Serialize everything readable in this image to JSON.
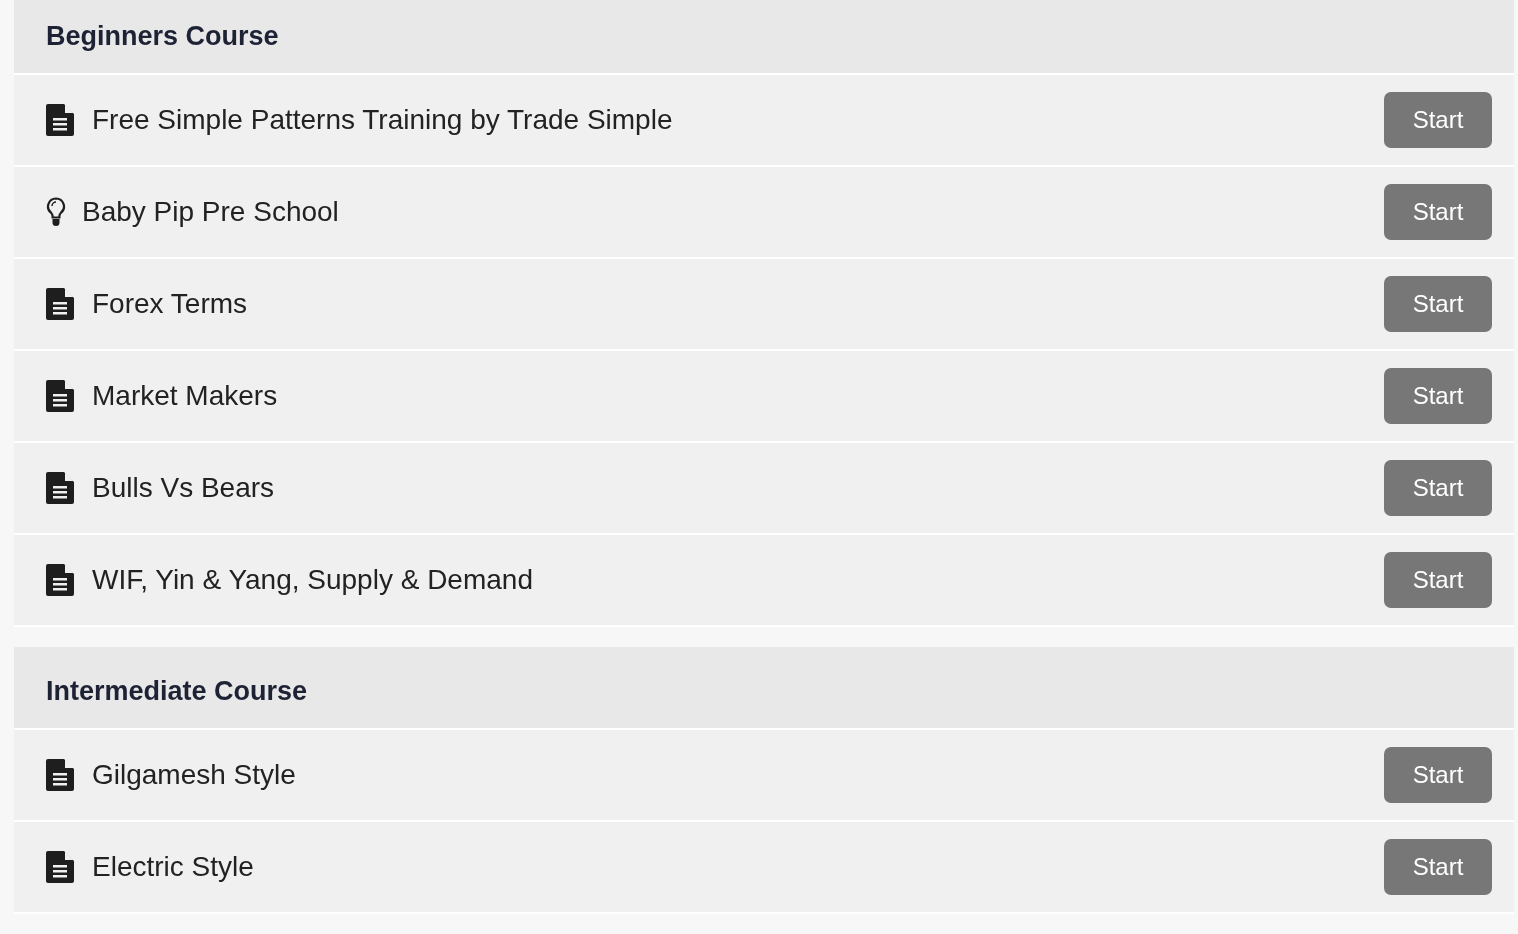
{
  "sections": [
    {
      "title": "Beginners Course",
      "lessons": [
        {
          "kind": "document",
          "title": "Free Simple Patterns Training by Trade Simple",
          "button": "Start"
        },
        {
          "kind": "bulb",
          "title": "Baby Pip Pre School",
          "button": "Start"
        },
        {
          "kind": "document",
          "title": "Forex Terms",
          "button": "Start"
        },
        {
          "kind": "document",
          "title": "Market Makers",
          "button": "Start"
        },
        {
          "kind": "document",
          "title": "Bulls Vs Bears",
          "button": "Start"
        },
        {
          "kind": "document",
          "title": "WIF, Yin & Yang, Supply & Demand",
          "button": "Start"
        }
      ]
    },
    {
      "title": "Intermediate Course",
      "lessons": [
        {
          "kind": "document",
          "title": "Gilgamesh Style",
          "button": "Start"
        },
        {
          "kind": "document",
          "title": "Electric Style",
          "button": "Start"
        }
      ]
    }
  ]
}
